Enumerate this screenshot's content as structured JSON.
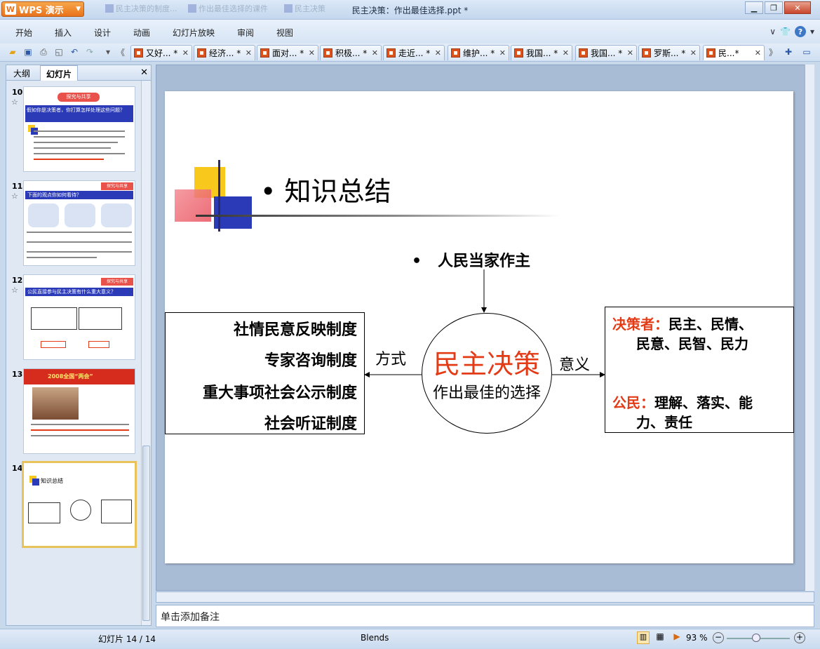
{
  "app": {
    "name": "WPS 演示",
    "logo_letter": "W",
    "document_title": "民主决策：作出最佳选择.ppt *",
    "ghost_tabs": [
      "民主决策的制度...",
      "作出最佳选择的课件",
      "民主决策"
    ]
  },
  "menu": [
    "开始",
    "插入",
    "设计",
    "动画",
    "幻灯片放映",
    "审阅",
    "视图"
  ],
  "doc_tabs": [
    {
      "label": "又好... *",
      "active": false
    },
    {
      "label": "经济... *",
      "active": false
    },
    {
      "label": "面对... *",
      "active": false
    },
    {
      "label": "积极... *",
      "active": false
    },
    {
      "label": "走近... *",
      "active": false
    },
    {
      "label": "维护... *",
      "active": false
    },
    {
      "label": "我国... *",
      "active": false
    },
    {
      "label": "我国... *",
      "active": false
    },
    {
      "label": "罗斯... *",
      "active": false
    },
    {
      "label": "民...*",
      "active": true
    }
  ],
  "panel": {
    "tabs": [
      "大纲",
      "幻灯片"
    ],
    "active_tab": "幻灯片",
    "thumbnails": [
      {
        "num": "10",
        "star": "☆",
        "banner": "探究与共享",
        "heading": "假如你是决策者，你打算怎样处理这些问题？"
      },
      {
        "num": "11",
        "star": "☆",
        "banner": "探究与共享",
        "heading": "下面的观点你如何看待？"
      },
      {
        "num": "12",
        "star": "☆",
        "banner": "探究与共享",
        "heading": "公民直接参与民主决策有什么重大意义？"
      },
      {
        "num": "13",
        "star": "",
        "banner": "2008全国“两会”",
        "heading": ""
      },
      {
        "num": "14",
        "star": "",
        "banner": "",
        "heading": "知识总结"
      }
    ]
  },
  "slide": {
    "title": "知识总结",
    "top_item": "人民当家作主",
    "center_main": "民主决策",
    "center_sub": "作出最佳的选择",
    "left_label": "方式",
    "right_label": "意义",
    "left_items": [
      "社情民意反映制度",
      "专家咨询制度",
      "重大事项社会公示制度",
      "社会听证制度"
    ],
    "right_block1_label": "决策者：",
    "right_block1_line1": "民主、民情、",
    "right_block1_line2": "民意、民智、民力",
    "right_block2_label": "公民：",
    "right_block2_line1": "理解、落实、能",
    "right_block2_line2": "力、责任",
    "colors": {
      "accent_red": "#e33b16",
      "dark_blue": "#2b3bb8",
      "yellow": "#f8c91c"
    }
  },
  "notes_placeholder": "单击添加备注",
  "status": {
    "slide_counter": "幻灯片 14 / 14",
    "theme": "Blends",
    "zoom": "93 %"
  }
}
